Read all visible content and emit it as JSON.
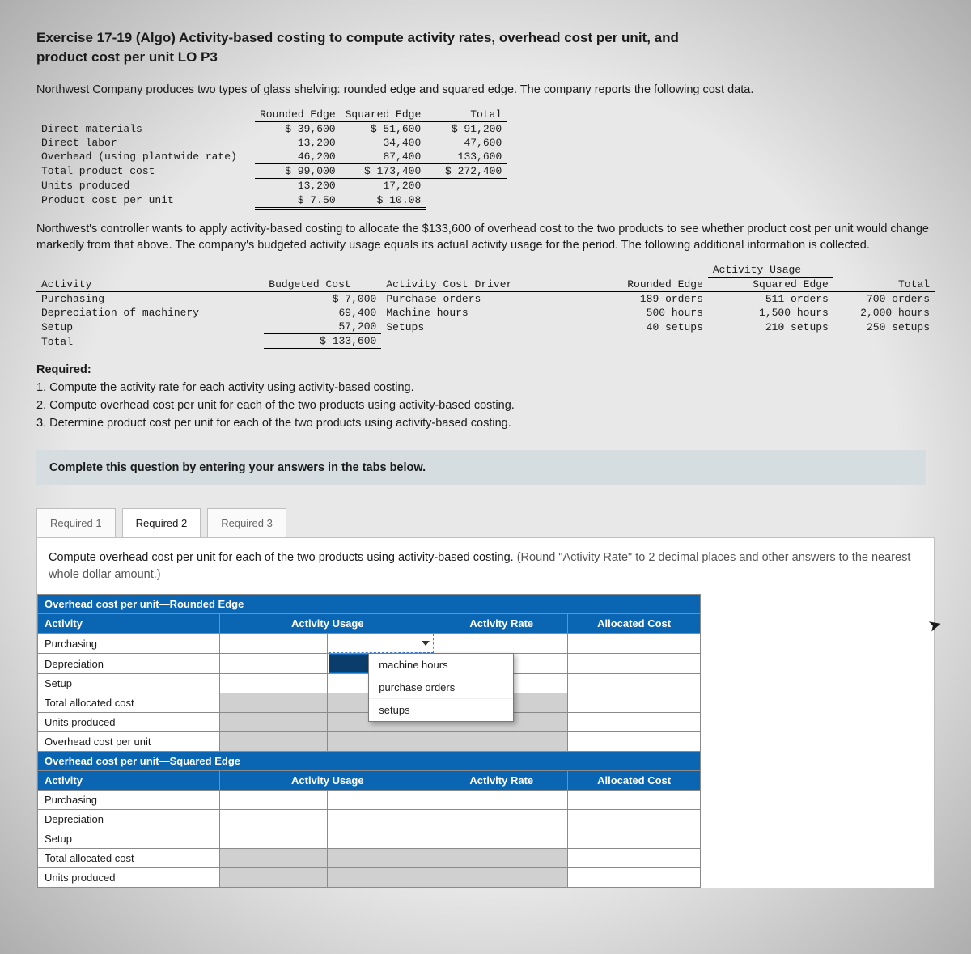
{
  "title_line1": "Exercise 17-19 (Algo) Activity-based costing to compute activity rates, overhead cost per unit, and",
  "title_line2": "product cost per unit LO P3",
  "intro": "Northwest Company produces two types of glass shelving: rounded edge and squared edge. The company reports the following cost data.",
  "cost_table": {
    "headers": [
      "",
      "Rounded Edge",
      "Squared Edge",
      "Total"
    ],
    "rows": [
      {
        "label": "Direct materials",
        "r": "$ 39,600",
        "s": "$ 51,600",
        "t": "$ 91,200"
      },
      {
        "label": "Direct labor",
        "r": "13,200",
        "s": "34,400",
        "t": "47,600"
      },
      {
        "label": "Overhead (using plantwide rate)",
        "r": "46,200",
        "s": "87,400",
        "t": "133,600"
      },
      {
        "label": "Total product cost",
        "r": "$ 99,000",
        "s": "$ 173,400",
        "t": "$ 272,400"
      },
      {
        "label": "Units produced",
        "r": "13,200",
        "s": "17,200",
        "t": ""
      },
      {
        "label": "Product cost per unit",
        "r": "$ 7.50",
        "s": "$ 10.08",
        "t": ""
      }
    ]
  },
  "mid_para": "Northwest's controller wants to apply activity-based costing to allocate the $133,600 of overhead cost to the two products to see whether product cost per unit would change markedly from that above. The company's budgeted activity usage equals its actual activity usage for the period. The following additional information is collected.",
  "act_table": {
    "usage_header": "Activity Usage",
    "cols": [
      "Activity",
      "Budgeted Cost",
      "Activity Cost Driver",
      "Rounded Edge",
      "Squared Edge",
      "Total"
    ],
    "rows": [
      {
        "a": "Purchasing",
        "b": "$ 7,000",
        "d": "Purchase orders",
        "r": "189 orders",
        "s": "511 orders",
        "t": "700 orders"
      },
      {
        "a": "Depreciation of machinery",
        "b": "69,400",
        "d": "Machine hours",
        "r": "500 hours",
        "s": "1,500 hours",
        "t": "2,000 hours"
      },
      {
        "a": "Setup",
        "b": "57,200",
        "d": "Setups",
        "r": "40 setups",
        "s": "210 setups",
        "t": "250 setups"
      },
      {
        "a": "Total",
        "b": "$ 133,600",
        "d": "",
        "r": "",
        "s": "",
        "t": ""
      }
    ]
  },
  "required": {
    "header": "Required:",
    "items": [
      "1. Compute the activity rate for each activity using activity-based costing.",
      "2. Compute overhead cost per unit for each of the two products using activity-based costing.",
      "3. Determine product cost per unit for each of the two products using activity-based costing."
    ]
  },
  "instr_bar": "Complete this question by entering your answers in the tabs below.",
  "tabs": {
    "t1": "Required 1",
    "t2": "Required 2",
    "t3": "Required 3"
  },
  "panel_instr": "Compute overhead cost per unit for each of the two products using activity-based costing. ",
  "panel_hint": "(Round \"Activity Rate\" to 2 decimal places and other answers to the nearest whole dollar amount.)",
  "ans": {
    "section1": "Overhead cost per unit—Rounded Edge",
    "section2": "Overhead cost per unit—Squared Edge",
    "cols": {
      "activity": "Activity",
      "usage": "Activity Usage",
      "rate": "Activity Rate",
      "alloc": "Allocated Cost"
    },
    "rows1": [
      "Purchasing",
      "Depreciation",
      "Setup",
      "Total allocated cost",
      "Units produced",
      "Overhead cost per unit"
    ],
    "rows2": [
      "Purchasing",
      "Depreciation",
      "Setup",
      "Total allocated cost",
      "Units produced"
    ]
  },
  "dropdown_options": [
    "machine hours",
    "purchase orders",
    "setups"
  ]
}
